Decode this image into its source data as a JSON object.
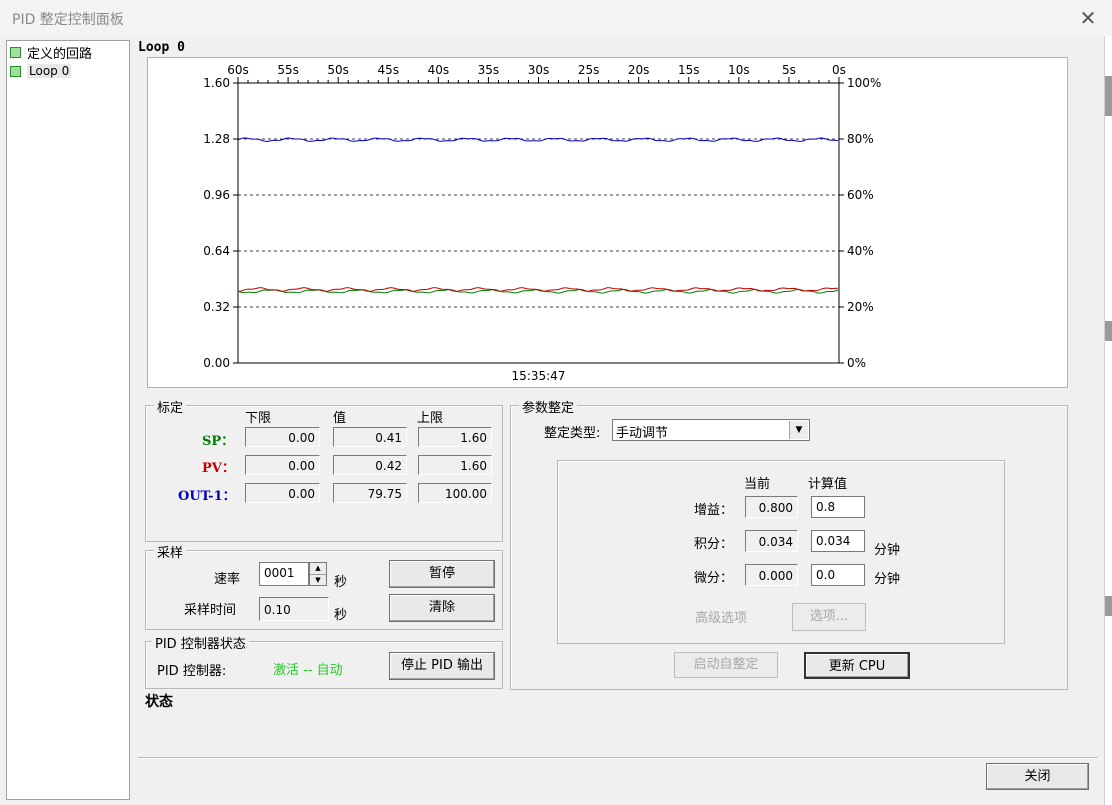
{
  "window": {
    "title": "PID 整定控制面板",
    "close_icon": "close-icon"
  },
  "tree": {
    "items": [
      {
        "label": "定义的回路",
        "icon": "folder-icon"
      },
      {
        "label": "Loop 0",
        "icon": "loop-icon"
      }
    ]
  },
  "loop_title": "Loop 0",
  "chart_data": {
    "type": "line",
    "time_ticks": [
      "60s",
      "55s",
      "50s",
      "45s",
      "40s",
      "35s",
      "30s",
      "25s",
      "20s",
      "15s",
      "10s",
      "5s",
      "0s"
    ],
    "left_ticks": [
      "1.60",
      "1.28",
      "0.96",
      "0.64",
      "0.32",
      "0.00"
    ],
    "right_ticks": [
      "100%",
      "80%",
      "60%",
      "40%",
      "20%",
      "0%"
    ],
    "ylim": [
      0,
      1.6
    ],
    "y2lim": [
      0,
      100
    ],
    "timestamp": "15:35:47",
    "grid": "dashed",
    "series": [
      {
        "name": "SP",
        "color": "#008000",
        "axis": "left",
        "value": 0.41
      },
      {
        "name": "PV",
        "color": "#c00000",
        "axis": "left",
        "value": 0.42
      },
      {
        "name": "OUT-1",
        "color": "#0000c0",
        "axis": "right",
        "value": 79.75
      }
    ]
  },
  "calib": {
    "title": "标定",
    "headers": {
      "low": "下限",
      "value": "值",
      "high": "上限"
    },
    "rows": [
      {
        "label": "SP：",
        "color": "#008000",
        "low": "0.00",
        "value": "0.41",
        "high": "1.60"
      },
      {
        "label": "PV：",
        "color": "#c00000",
        "low": "0.00",
        "value": "0.42",
        "high": "1.60"
      },
      {
        "label": "OUT-1：",
        "color": "#0000c0",
        "low": "0.00",
        "value": "79.75",
        "high": "100.00"
      }
    ]
  },
  "sampling": {
    "title": "采样",
    "rate_label": "速率",
    "rate_value": "0001",
    "rate_unit": "秒",
    "time_label": "采样时间",
    "time_value": "0.10",
    "time_unit": "秒",
    "pause_btn": "暂停",
    "clear_btn": "清除"
  },
  "pid_status": {
    "title": "PID 控制器状态",
    "label": "PID 控制器:",
    "value": "激活 -- 自动",
    "value_color": "#22cc22",
    "stop_btn": "停止 PID 输出"
  },
  "status_label": "状态",
  "tuning": {
    "title": "参数整定",
    "type_label": "整定类型:",
    "type_value": "手动调节",
    "col_current": "当前",
    "col_calc": "计算值",
    "gain_label": "增益：",
    "gain_current": "0.800",
    "gain_calc": "0.8",
    "integral_label": "积分：",
    "integral_current": "0.034",
    "integral_calc": "0.034",
    "integral_unit": "分钟",
    "derivative_label": "微分：",
    "derivative_current": "0.000",
    "derivative_calc": "0.0",
    "derivative_unit": "分钟",
    "advanced_label": "高级选项",
    "options_btn": "选项...",
    "autotune_btn": "启动自整定",
    "update_btn": "更新 CPU"
  },
  "close_btn": "关闭"
}
